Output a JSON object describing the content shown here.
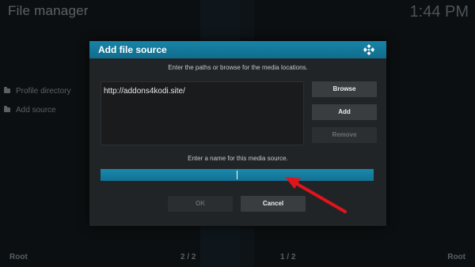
{
  "app": {
    "title": "File manager",
    "clock": "1:44 PM"
  },
  "sidebar": {
    "items": [
      {
        "label": "Profile directory",
        "icon": "folder-icon"
      },
      {
        "label": "Add source",
        "icon": "folder-icon"
      }
    ]
  },
  "footer": {
    "left_label": "Root",
    "left_page": "2 / 2",
    "right_page": "1 / 2",
    "right_label": "Root"
  },
  "dialog": {
    "title": "Add file source",
    "logo_icon": "kodi-logo-icon",
    "path_instruction": "Enter the paths or browse for the media locations.",
    "paths": [
      "http://addons4kodi.site/"
    ],
    "buttons": {
      "browse": "Browse",
      "add": "Add",
      "remove": "Remove"
    },
    "name_instruction": "Enter a name for this media source.",
    "name_value": "",
    "ok_label": "OK",
    "cancel_label": "Cancel"
  },
  "annotation": {
    "arrow_color": "#e0141c",
    "arrow_icon": "red-arrow-icon"
  },
  "colors": {
    "accent": "#14799b",
    "dialog_bg": "#212427",
    "button_bg": "#3a3d40"
  }
}
